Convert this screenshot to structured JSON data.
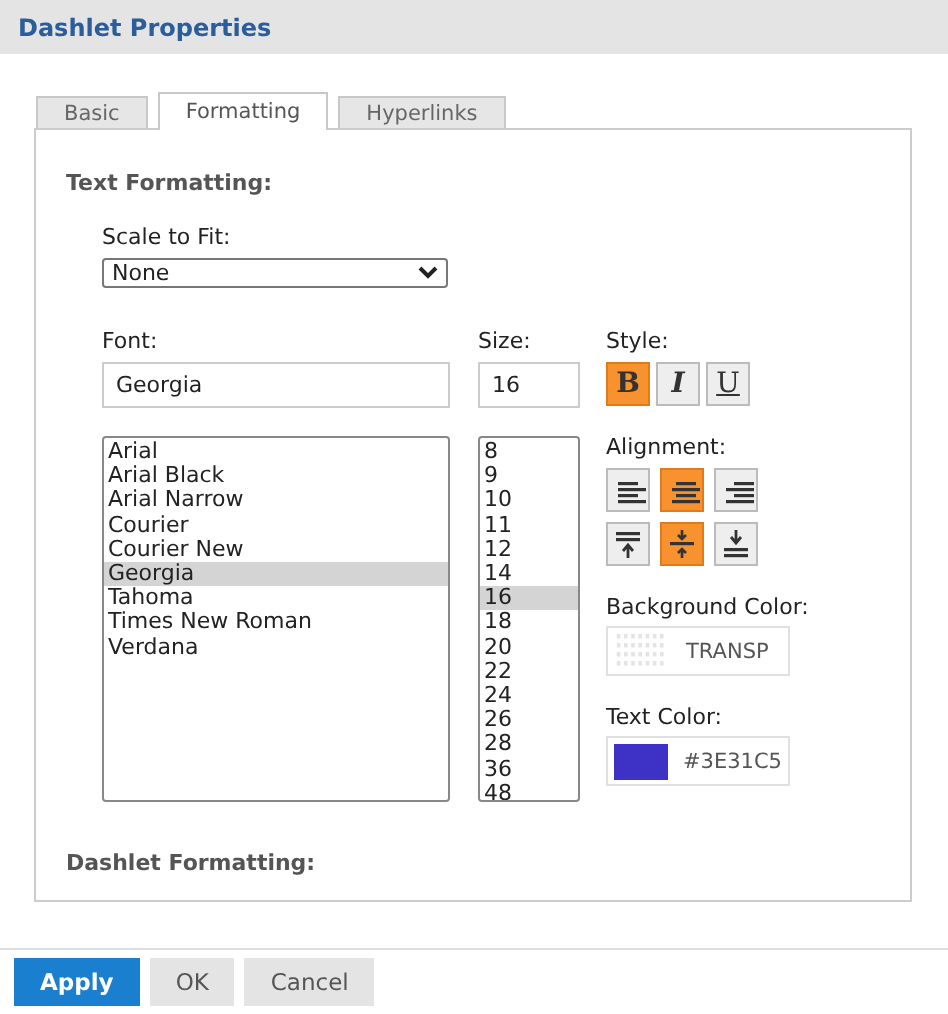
{
  "window": {
    "title": "Dashlet Properties"
  },
  "tabs": [
    {
      "label": "Basic",
      "selected": false
    },
    {
      "label": "Formatting",
      "selected": true
    },
    {
      "label": "Hyperlinks",
      "selected": false
    }
  ],
  "text_formatting": {
    "heading": "Text Formatting:",
    "scale_to_fit": {
      "label": "Scale to Fit:",
      "value": "None"
    },
    "font": {
      "label": "Font:",
      "value": "Georgia",
      "options": [
        {
          "label": "Arial",
          "selected": false
        },
        {
          "label": "Arial Black",
          "selected": false
        },
        {
          "label": "Arial Narrow",
          "selected": false
        },
        {
          "label": "Courier",
          "selected": false
        },
        {
          "label": "Courier New",
          "selected": false
        },
        {
          "label": "Georgia",
          "selected": true
        },
        {
          "label": "Tahoma",
          "selected": false
        },
        {
          "label": "Times New Roman",
          "selected": false
        },
        {
          "label": "Verdana",
          "selected": false
        }
      ]
    },
    "size": {
      "label": "Size:",
      "value": "16",
      "options": [
        {
          "label": "8",
          "selected": false
        },
        {
          "label": "9",
          "selected": false
        },
        {
          "label": "10",
          "selected": false
        },
        {
          "label": "11",
          "selected": false
        },
        {
          "label": "12",
          "selected": false
        },
        {
          "label": "14",
          "selected": false
        },
        {
          "label": "16",
          "selected": true
        },
        {
          "label": "18",
          "selected": false
        },
        {
          "label": "20",
          "selected": false
        },
        {
          "label": "22",
          "selected": false
        },
        {
          "label": "24",
          "selected": false
        },
        {
          "label": "26",
          "selected": false
        },
        {
          "label": "28",
          "selected": false
        },
        {
          "label": "36",
          "selected": false
        },
        {
          "label": "48",
          "selected": false
        }
      ]
    },
    "style": {
      "label": "Style:",
      "buttons": [
        {
          "kind": "bold",
          "label": "B",
          "selected": true
        },
        {
          "kind": "italic",
          "label": "I",
          "selected": false
        },
        {
          "kind": "underline",
          "label": "U",
          "selected": false
        }
      ]
    },
    "alignment": {
      "label": "Alignment:",
      "buttons": [
        {
          "kind": "left",
          "selected": false
        },
        {
          "kind": "center",
          "selected": true
        },
        {
          "kind": "right",
          "selected": false
        },
        {
          "kind": "top",
          "selected": false
        },
        {
          "kind": "middle",
          "selected": true
        },
        {
          "kind": "bottom",
          "selected": false
        }
      ]
    },
    "background_color": {
      "label": "Background Color:",
      "value": "TRANSP"
    },
    "text_color": {
      "label": "Text Color:",
      "value": "#3E31C5",
      "color": "#3e31c5"
    }
  },
  "dashlet_formatting": {
    "heading": "Dashlet Formatting:"
  },
  "buttons": [
    {
      "label": "Apply",
      "kind": "primary"
    },
    {
      "label": "OK",
      "kind": "secondary"
    },
    {
      "label": "Cancel",
      "kind": "secondary"
    }
  ]
}
